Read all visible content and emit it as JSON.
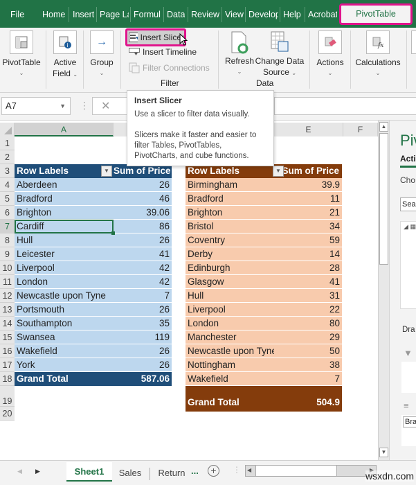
{
  "menubar": {
    "tabs": [
      "File",
      "Home",
      "Insert",
      "Page La",
      "Formul",
      "Data",
      "Review",
      "View",
      "Develop",
      "Help",
      "Acrobat"
    ],
    "active_tab": "PivotTable Analyze"
  },
  "ribbon": {
    "pivottable": "PivotTable",
    "active_field_1": "Active",
    "active_field_2": "Field",
    "group": "Group",
    "insert_slicer": "Insert Slicer",
    "insert_timeline": "Insert Timeline",
    "filter_connections": "Filter Connections",
    "filter_group": "Filter",
    "refresh": "Refresh",
    "change_data_1": "Change Data",
    "change_data_2": "Source",
    "data_group": "Data",
    "actions": "Actions",
    "calculations": "Calculations"
  },
  "formula": {
    "name_box": "A7"
  },
  "tooltip": {
    "title": "Insert Slicer",
    "line1": "Use a slicer to filter data visually.",
    "line2": "Slicers make it faster and easier to filter Tables, PivotTables, PivotCharts, and cube functions."
  },
  "columns": [
    "A",
    "E",
    "F"
  ],
  "rows": [
    "1",
    "2",
    "3",
    "4",
    "5",
    "6",
    "7",
    "8",
    "9",
    "10",
    "11",
    "12",
    "13",
    "14",
    "15",
    "16",
    "17",
    "18",
    "19",
    "20"
  ],
  "left_pivot": {
    "header_label": "Row Labels",
    "header_value": "Sum of Price",
    "rows": [
      {
        "label": "Aberdeen",
        "value": "26"
      },
      {
        "label": "Bradford",
        "value": "46"
      },
      {
        "label": "Brighton",
        "value": "39.06"
      },
      {
        "label": "Cardiff",
        "value": "86"
      },
      {
        "label": "Hull",
        "value": "26"
      },
      {
        "label": "Leicester",
        "value": "41"
      },
      {
        "label": "Liverpool",
        "value": "42"
      },
      {
        "label": "London",
        "value": "42"
      },
      {
        "label": "Newcastle upon Tyne",
        "value": "7"
      },
      {
        "label": "Portsmouth",
        "value": "26"
      },
      {
        "label": "Southampton",
        "value": "35"
      },
      {
        "label": "Swansea",
        "value": "119"
      },
      {
        "label": "Wakefield",
        "value": "26"
      },
      {
        "label": "York",
        "value": "26"
      }
    ],
    "total_label": "Grand Total",
    "total_value": "587.06",
    "colors": {
      "header": "#1f4e79",
      "row": "#bdd7ee"
    }
  },
  "right_pivot": {
    "header_label": "Row Labels",
    "header_value": "Sum of Price",
    "rows": [
      {
        "label": "Birmingham",
        "value": "39.9"
      },
      {
        "label": "Bradford",
        "value": "11"
      },
      {
        "label": "Brighton",
        "value": "21"
      },
      {
        "label": "Bristol",
        "value": "34"
      },
      {
        "label": "Coventry",
        "value": "59"
      },
      {
        "label": "Derby",
        "value": "14"
      },
      {
        "label": "Edinburgh",
        "value": "28"
      },
      {
        "label": "Glasgow",
        "value": "41"
      },
      {
        "label": "Hull",
        "value": "31"
      },
      {
        "label": "Liverpool",
        "value": "22"
      },
      {
        "label": "London",
        "value": "80"
      },
      {
        "label": "Manchester",
        "value": "29"
      },
      {
        "label": "Newcastle upon Tyne",
        "value": "50"
      },
      {
        "label": "Nottingham",
        "value": "38"
      },
      {
        "label": "Wakefield",
        "value": "7"
      }
    ],
    "total_label": "Grand Total",
    "total_value": "504.9",
    "colors": {
      "header": "#843c0c",
      "row": "#f8cbad"
    }
  },
  "pane": {
    "title": "Piv",
    "active_tab": "Acti",
    "choose": "Cho",
    "search": "Sear",
    "drag": "Dra",
    "field": "Bra"
  },
  "sheets": {
    "tabs": [
      "Sheet1",
      "Sales",
      "Return"
    ],
    "active": "Sheet1",
    "more": "..."
  },
  "watermark": "wsxdn.com"
}
